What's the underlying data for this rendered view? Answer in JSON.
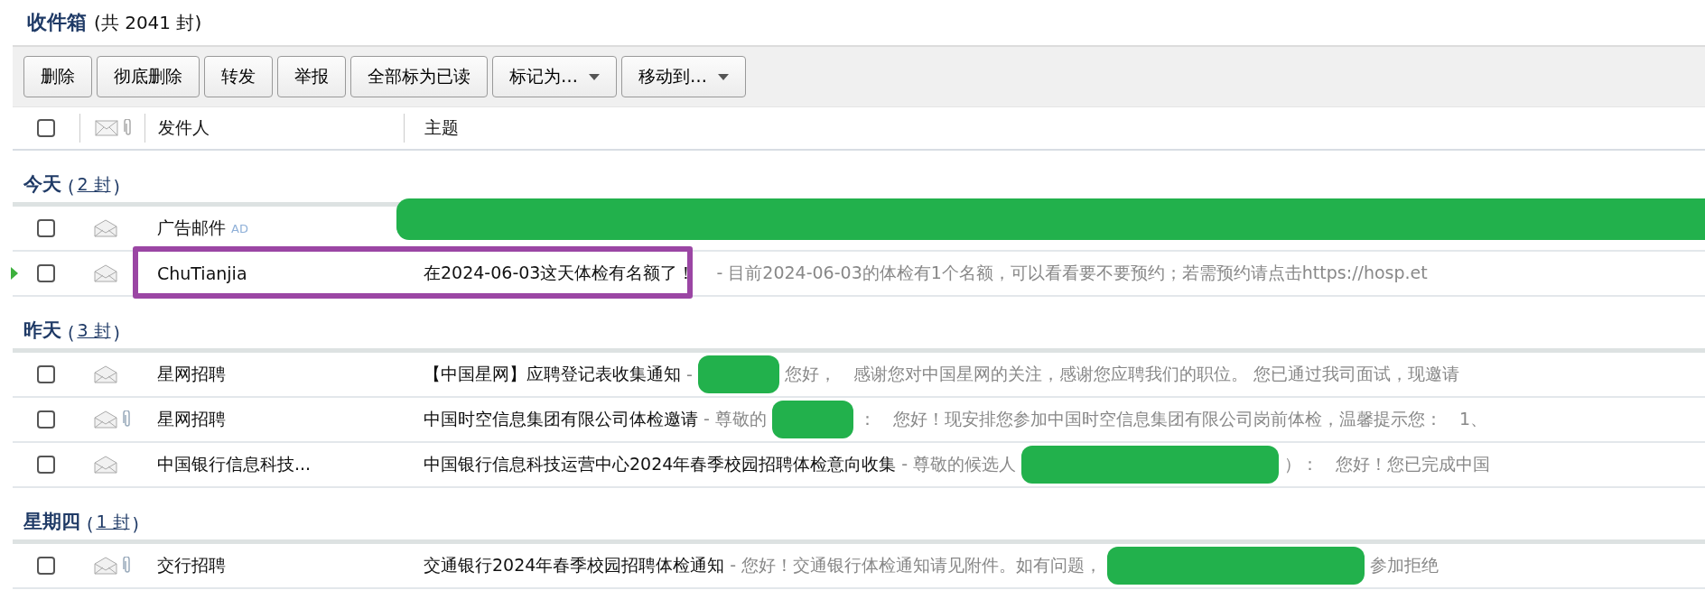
{
  "title": {
    "name": "收件箱",
    "count": "(共 2041 封)"
  },
  "toolbar": [
    {
      "label": "删除",
      "dropdown": false
    },
    {
      "label": "彻底删除",
      "dropdown": false
    },
    {
      "label": "转发",
      "dropdown": false
    },
    {
      "label": "举报",
      "dropdown": false
    },
    {
      "label": "全部标为已读",
      "dropdown": false
    },
    {
      "label": "标记为…",
      "dropdown": true
    },
    {
      "label": "移动到…",
      "dropdown": true
    }
  ],
  "select_all": {
    "checked": false
  },
  "columns": {
    "sender": "发件人",
    "subject": "主题"
  },
  "groups": [
    {
      "label": "今天",
      "count_prefix": "(",
      "count": "2 封",
      "count_suffix": ")",
      "rows": [
        {
          "sender": "广告邮件",
          "badge": "AD",
          "attachment": false,
          "current": false,
          "highlighted": false,
          "checked": false,
          "subject": "",
          "preview": [
            {
              "kind": "redaction-full"
            }
          ]
        },
        {
          "sender": "ChuTianjia",
          "attachment": false,
          "current": true,
          "highlighted": true,
          "checked": false,
          "subject": "在2024-06-03这天体检有名额了！",
          "preview": [
            {
              "kind": "text",
              "text": "- 目前2024-06-03的体检有1个名额，可以看看要不要预约；若需预约请点击https://hosp.et"
            }
          ]
        }
      ]
    },
    {
      "label": "昨天",
      "count_prefix": "(",
      "count": "3 封",
      "count_suffix": ")",
      "rows": [
        {
          "sender": "星网招聘",
          "attachment": false,
          "current": false,
          "highlighted": false,
          "checked": false,
          "subject": "【中国星网】应聘登记表收集通知",
          "preview": [
            {
              "kind": "text",
              "text": "-"
            },
            {
              "kind": "redaction-small"
            },
            {
              "kind": "text",
              "text": "您好，　感谢您对中国星网的关注，感谢您应聘我们的职位。 您已通过我司面试，现邀请"
            }
          ]
        },
        {
          "sender": "星网招聘",
          "attachment": true,
          "current": false,
          "highlighted": false,
          "checked": false,
          "subject": "中国时空信息集团有限公司体检邀请",
          "preview": [
            {
              "kind": "text",
              "text": "- 尊敬的"
            },
            {
              "kind": "redaction-small"
            },
            {
              "kind": "text",
              "text": "：　您好！现安排您参加中国时空信息集团有限公司岗前体检，温馨提示您：　1、"
            }
          ]
        },
        {
          "sender": "中国银行信息科技...",
          "attachment": false,
          "current": false,
          "highlighted": false,
          "checked": false,
          "subject": "中国银行信息科技运营中心2024年春季校园招聘体检意向收集",
          "preview": [
            {
              "kind": "text",
              "text": "- 尊敬的候选人"
            },
            {
              "kind": "redaction-large"
            },
            {
              "kind": "text",
              "text": "）：　您好！您已完成中国"
            }
          ]
        }
      ]
    },
    {
      "label": "星期四",
      "count_prefix": "(",
      "count": "1 封",
      "count_suffix": ")",
      "rows": [
        {
          "sender": "交行招聘",
          "attachment": true,
          "current": false,
          "highlighted": false,
          "checked": false,
          "subject": "交通银行2024年春季校园招聘体检通知",
          "preview": [
            {
              "kind": "text",
              "text": "- 您好！交通银行体检通知请见附件。如有问题，"
            },
            {
              "kind": "redaction-large"
            },
            {
              "kind": "text",
              "text": "参加拒绝"
            }
          ]
        }
      ]
    }
  ]
}
